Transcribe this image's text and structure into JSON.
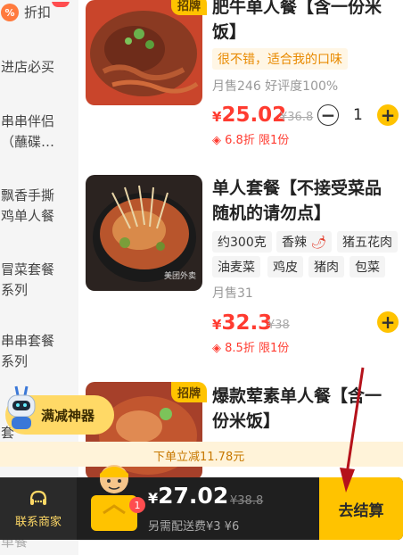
{
  "sidebar": {
    "first": "折扣",
    "items": [
      "进店必买",
      "串串伴侣\n（蘸碟…",
      "飘香手撕\n鸡单人餐",
      "冒菜套餐\n系列",
      "串串套餐\n系列",
      "套",
      "单餐"
    ]
  },
  "items": [
    {
      "title": "肥牛单人餐【含一份米饭】",
      "tag": "招牌",
      "comment": "很不错，适合我的口味",
      "sales": "月售246  好评度100%",
      "currency": "¥",
      "price": "25.02",
      "original": "¥36.8",
      "discount": "6.8折 限1份",
      "quantity": "1",
      "minus": "−",
      "plus": "+"
    },
    {
      "title": "单人套餐【不接受菜品随机的请勿点】",
      "chips": [
        "约300克",
        "香辣",
        "猪五花肉",
        "油麦菜",
        "鸡皮",
        "猪肉",
        "包菜"
      ],
      "sales": "月售31",
      "currency": "¥",
      "price": "32.3",
      "original": "¥38",
      "discount": "8.5折 限1份",
      "plus": "+",
      "image_watermark": "美团外卖"
    },
    {
      "title": "爆款荤素单人餐【含一份米饭】",
      "tag": "招牌"
    }
  ],
  "coupon": {
    "label": "满减神器"
  },
  "promo": {
    "text": "下单立减11.78元"
  },
  "cart": {
    "contact_label": "联系商家",
    "badge": "1",
    "currency": "¥",
    "price": "27.02",
    "original": "¥38.8",
    "fee": "另需配送费¥3 ¥6",
    "checkout": "去结算"
  },
  "colors": {
    "accent": "#ffc300",
    "price_red": "#ff3b30",
    "bar_dark": "#1f1f1f",
    "annotation_arrow": "#b5121b"
  }
}
